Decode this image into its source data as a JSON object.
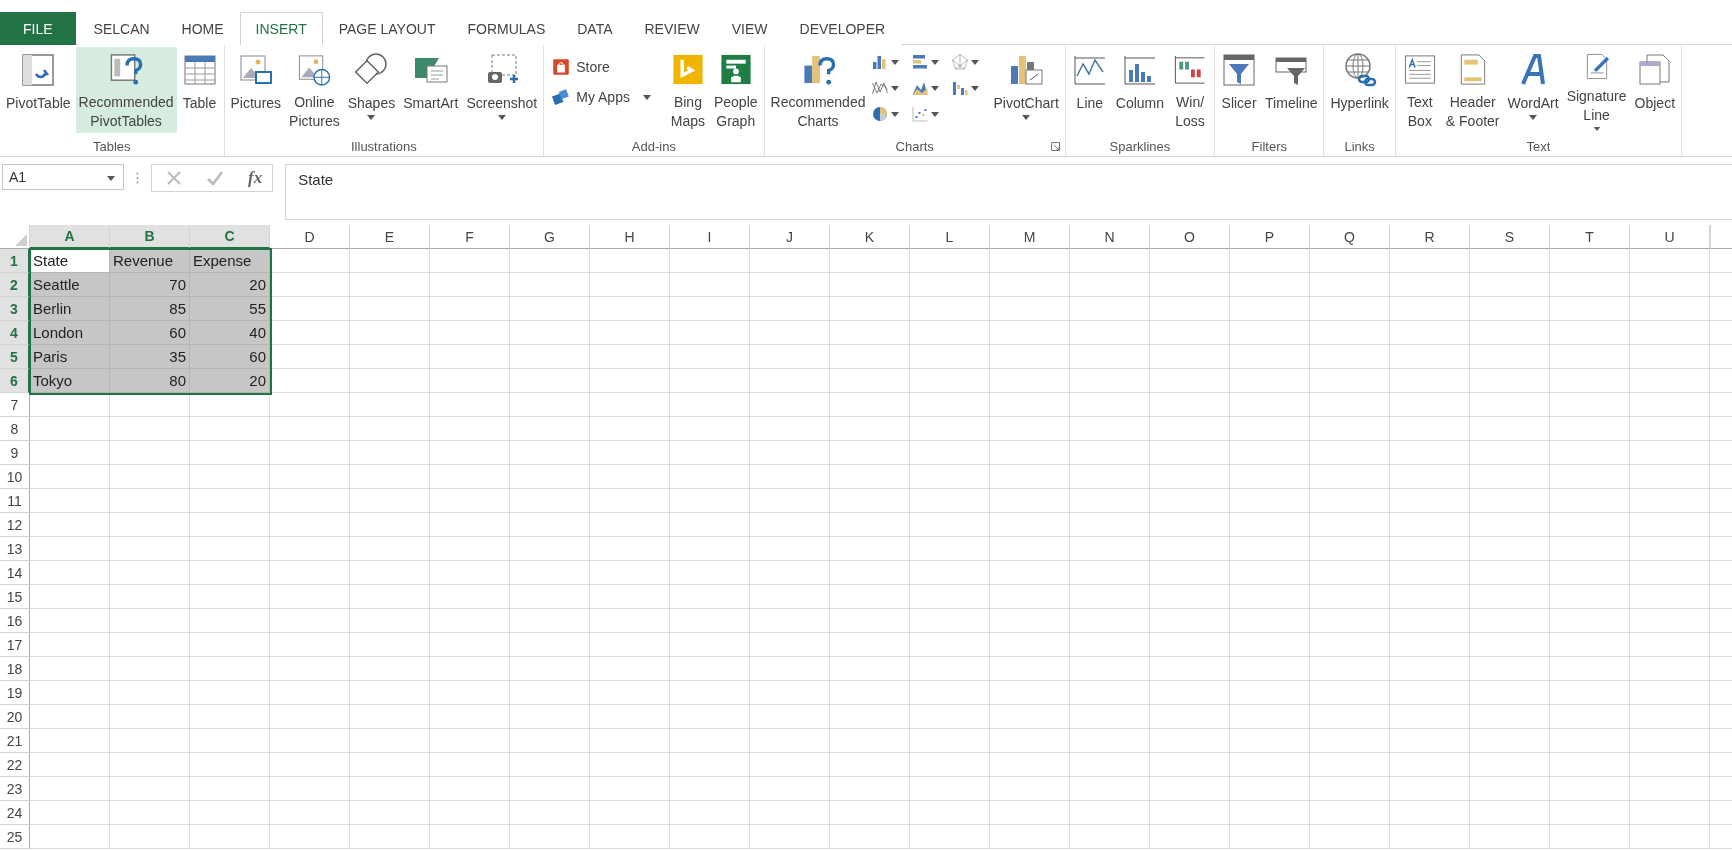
{
  "ribbon_tabs": [
    {
      "label": "FILE",
      "kind": "file",
      "selected": false
    },
    {
      "label": "SELCAN",
      "kind": "tab",
      "selected": false
    },
    {
      "label": "HOME",
      "kind": "tab",
      "selected": false
    },
    {
      "label": "INSERT",
      "kind": "tab",
      "selected": true
    },
    {
      "label": "PAGE LAYOUT",
      "kind": "tab",
      "selected": false
    },
    {
      "label": "FORMULAS",
      "kind": "tab",
      "selected": false
    },
    {
      "label": "DATA",
      "kind": "tab",
      "selected": false
    },
    {
      "label": "REVIEW",
      "kind": "tab",
      "selected": false
    },
    {
      "label": "VIEW",
      "kind": "tab",
      "selected": false
    },
    {
      "label": "DEVELOPER",
      "kind": "tab",
      "selected": false
    }
  ],
  "ribbon_groups": [
    {
      "label": "Tables",
      "items": [
        {
          "kind": "large",
          "label": "PivotTable",
          "selected": false
        },
        {
          "kind": "large",
          "label": "Recommended\nPivotTables",
          "selected": true
        },
        {
          "kind": "large",
          "label": "Table",
          "selected": false
        }
      ]
    },
    {
      "label": "Illustrations",
      "items": [
        {
          "kind": "large",
          "label": "Pictures",
          "selected": false
        },
        {
          "kind": "large",
          "label": "Online\nPictures",
          "selected": false
        },
        {
          "kind": "large",
          "label": "Shapes",
          "dropdown": true,
          "selected": false
        },
        {
          "kind": "large",
          "label": "SmartArt",
          "selected": false
        },
        {
          "kind": "large",
          "label": "Screenshot",
          "dropdown": true,
          "selected": false
        }
      ]
    },
    {
      "label": "Add-ins",
      "items": [
        {
          "kind": "stack",
          "children": [
            {
              "label": "Store"
            },
            {
              "label": "My Apps",
              "dropdown": true
            }
          ]
        },
        {
          "kind": "large",
          "label": "Bing\nMaps",
          "selected": false
        },
        {
          "kind": "large",
          "label": "People\nGraph",
          "selected": false
        }
      ]
    },
    {
      "label": "Charts",
      "launcher": true,
      "items": [
        {
          "kind": "large",
          "label": "Recommended\nCharts",
          "selected": false
        },
        {
          "kind": "icongrid",
          "children": [
            {
              "dropdown": true
            },
            {
              "dropdown": true
            },
            {
              "dropdown": true
            },
            {
              "dropdown": true
            },
            {
              "dropdown": true
            },
            {
              "dropdown": true
            },
            {
              "dropdown": true
            },
            {
              "dropdown": true
            }
          ]
        },
        {
          "kind": "large",
          "label": "PivotChart",
          "dropdown": true,
          "selected": false
        }
      ]
    },
    {
      "label": "Sparklines",
      "items": [
        {
          "kind": "large",
          "label": "Line",
          "selected": false
        },
        {
          "kind": "large",
          "label": "Column",
          "selected": false
        },
        {
          "kind": "large",
          "label": "Win/\nLoss",
          "selected": false
        }
      ]
    },
    {
      "label": "Filters",
      "items": [
        {
          "kind": "large",
          "label": "Slicer",
          "selected": false
        },
        {
          "kind": "large",
          "label": "Timeline",
          "selected": false
        }
      ]
    },
    {
      "label": "Links",
      "items": [
        {
          "kind": "large",
          "label": "Hyperlink",
          "selected": false
        }
      ]
    },
    {
      "label": "Text",
      "items": [
        {
          "kind": "large",
          "label": "Text\nBox",
          "selected": false
        },
        {
          "kind": "large",
          "label": "Header\n& Footer",
          "selected": false
        },
        {
          "kind": "large",
          "label": "WordArt",
          "dropdown": true,
          "selected": false
        },
        {
          "kind": "large",
          "label": "Signature\nLine",
          "dropdown": true,
          "selected": false
        },
        {
          "kind": "large",
          "label": "Object",
          "selected": false
        }
      ]
    }
  ],
  "formula_bar": {
    "name_box": "A1",
    "function_label": "fx",
    "formula": "State"
  },
  "sheet": {
    "columns": [
      {
        "label": "A",
        "selected": true
      },
      {
        "label": "B",
        "selected": true
      },
      {
        "label": "C",
        "selected": true
      },
      {
        "label": "D",
        "selected": false
      },
      {
        "label": "E",
        "selected": false
      },
      {
        "label": "F",
        "selected": false
      },
      {
        "label": "G",
        "selected": false
      },
      {
        "label": "H",
        "selected": false
      },
      {
        "label": "I",
        "selected": false
      },
      {
        "label": "J",
        "selected": false
      },
      {
        "label": "K",
        "selected": false
      },
      {
        "label": "L",
        "selected": false
      },
      {
        "label": "M",
        "selected": false
      },
      {
        "label": "N",
        "selected": false
      },
      {
        "label": "O",
        "selected": false
      },
      {
        "label": "P",
        "selected": false
      },
      {
        "label": "Q",
        "selected": false
      },
      {
        "label": "R",
        "selected": false
      },
      {
        "label": "S",
        "selected": false
      },
      {
        "label": "T",
        "selected": false
      },
      {
        "label": "U",
        "selected": false
      }
    ],
    "rows": [
      {
        "header": "1",
        "selected": true,
        "cells": [
          {
            "text": "State",
            "kind": "text",
            "selected": true,
            "active": true
          },
          {
            "text": "Revenue",
            "kind": "text",
            "selected": true,
            "active": false
          },
          {
            "text": "Expense",
            "kind": "text",
            "selected": true,
            "active": false
          }
        ]
      },
      {
        "header": "2",
        "selected": true,
        "cells": [
          {
            "text": "Seattle",
            "kind": "text",
            "selected": true,
            "active": false
          },
          {
            "text": "70",
            "kind": "number",
            "selected": true,
            "active": false
          },
          {
            "text": "20",
            "kind": "number",
            "selected": true,
            "active": false
          }
        ]
      },
      {
        "header": "3",
        "selected": true,
        "cells": [
          {
            "text": "Berlin",
            "kind": "text",
            "selected": true,
            "active": false
          },
          {
            "text": "85",
            "kind": "number",
            "selected": true,
            "active": false
          },
          {
            "text": "55",
            "kind": "number",
            "selected": true,
            "active": false
          }
        ]
      },
      {
        "header": "4",
        "selected": true,
        "cells": [
          {
            "text": "London",
            "kind": "text",
            "selected": true,
            "active": false
          },
          {
            "text": "60",
            "kind": "number",
            "selected": true,
            "active": false
          },
          {
            "text": "40",
            "kind": "number",
            "selected": true,
            "active": false
          }
        ]
      },
      {
        "header": "5",
        "selected": true,
        "cells": [
          {
            "text": "Paris",
            "kind": "text",
            "selected": true,
            "active": false
          },
          {
            "text": "35",
            "kind": "number",
            "selected": true,
            "active": false
          },
          {
            "text": "60",
            "kind": "number",
            "selected": true,
            "active": false
          }
        ]
      },
      {
        "header": "6",
        "selected": true,
        "cells": [
          {
            "text": "Tokyo",
            "kind": "text",
            "selected": true,
            "active": false
          },
          {
            "text": "80",
            "kind": "number",
            "selected": true,
            "active": false
          },
          {
            "text": "20",
            "kind": "number",
            "selected": true,
            "active": false
          }
        ]
      },
      {
        "header": "7",
        "selected": false
      },
      {
        "header": "8",
        "selected": false
      },
      {
        "header": "9",
        "selected": false
      },
      {
        "header": "10",
        "selected": false
      },
      {
        "header": "11",
        "selected": false
      },
      {
        "header": "12",
        "selected": false
      },
      {
        "header": "13",
        "selected": false
      },
      {
        "header": "14",
        "selected": false
      },
      {
        "header": "15",
        "selected": false
      },
      {
        "header": "16",
        "selected": false
      },
      {
        "header": "17",
        "selected": false
      },
      {
        "header": "18",
        "selected": false
      },
      {
        "header": "19",
        "selected": false
      },
      {
        "header": "20",
        "selected": false
      },
      {
        "header": "21",
        "selected": false
      },
      {
        "header": "22",
        "selected": false
      },
      {
        "header": "23",
        "selected": false
      },
      {
        "header": "24",
        "selected": false
      },
      {
        "header": "25",
        "selected": false
      }
    ]
  }
}
